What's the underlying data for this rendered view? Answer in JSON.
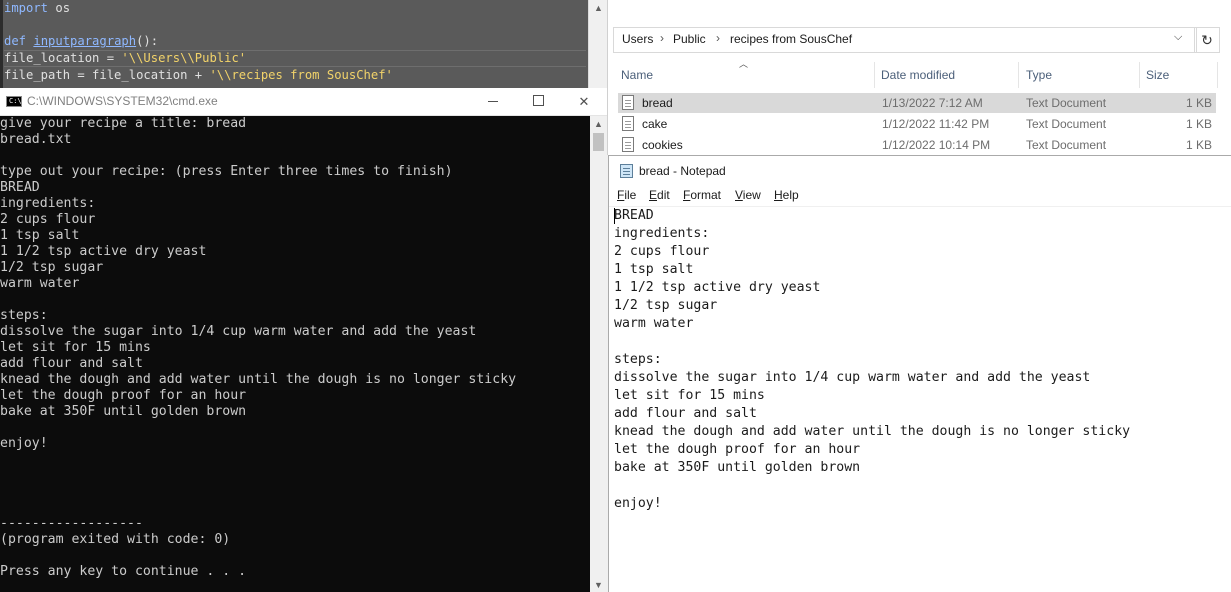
{
  "editor": {
    "line1": {
      "kw": "import",
      "rest": " os"
    },
    "line2": "",
    "line3": {
      "kw": "def",
      "fn": "inputparagraph",
      "rest": "():"
    },
    "line4": {
      "var": "file_location = ",
      "str": "'\\\\Users\\\\Public'"
    },
    "line5": {
      "var": "file_path = file_location + ",
      "str": "'\\\\recipes from SousChef'"
    }
  },
  "cmd": {
    "title": "C:\\WINDOWS\\SYSTEM32\\cmd.exe",
    "icon_text": "C:\\",
    "lines": [
      "give your recipe a title: bread",
      "bread.txt",
      "",
      "type out your recipe: (press Enter three times to finish)",
      "BREAD",
      "ingredients:",
      "2 cups flour",
      "1 tsp salt",
      "1 1/2 tsp active dry yeast",
      "1/2 tsp sugar",
      "warm water",
      "",
      "steps:",
      "dissolve the sugar into 1/4 cup warm water and add the yeast",
      "let sit for 15 mins",
      "add flour and salt",
      "knead the dough and add water until the dough is no longer sticky",
      "let the dough proof for an hour",
      "bake at 350F until golden brown",
      "",
      "enjoy!",
      "",
      "",
      "",
      "",
      "------------------",
      "(program exited with code: 0)",
      "",
      "Press any key to continue . . ."
    ]
  },
  "explorer": {
    "breadcrumb": [
      "Users",
      "Public",
      "recipes from SousChef"
    ],
    "columns": {
      "name": "Name",
      "date": "Date modified",
      "type": "Type",
      "size": "Size"
    },
    "files": [
      {
        "name": "bread",
        "date": "1/13/2022 7:12 AM",
        "type": "Text Document",
        "size": "1 KB",
        "selected": true
      },
      {
        "name": "cake",
        "date": "1/12/2022 11:42 PM",
        "type": "Text Document",
        "size": "1 KB",
        "selected": false
      },
      {
        "name": "cookies",
        "date": "1/12/2022 10:14 PM",
        "type": "Text Document",
        "size": "1 KB",
        "selected": false
      }
    ]
  },
  "notepad": {
    "title": "bread - Notepad",
    "menu": [
      {
        "underline": "F",
        "rest": "ile"
      },
      {
        "underline": "E",
        "rest": "dit"
      },
      {
        "underline": "F",
        "rest": "ormat",
        "pre": ""
      },
      {
        "underline": "V",
        "rest": "iew"
      },
      {
        "underline": "H",
        "rest": "elp"
      }
    ],
    "lines": [
      "BREAD",
      "ingredients:",
      "2 cups flour",
      "1 tsp salt",
      "1 1/2 tsp active dry yeast",
      "1/2 tsp sugar",
      "warm water",
      "",
      "steps:",
      "dissolve the sugar into 1/4 cup warm water and add the yeast",
      "let sit for 15 mins",
      "add flour and salt",
      "knead the dough and add water until the dough is no longer sticky",
      "let the dough proof for an hour",
      "bake at 350F until golden brown",
      "",
      "enjoy!"
    ]
  }
}
